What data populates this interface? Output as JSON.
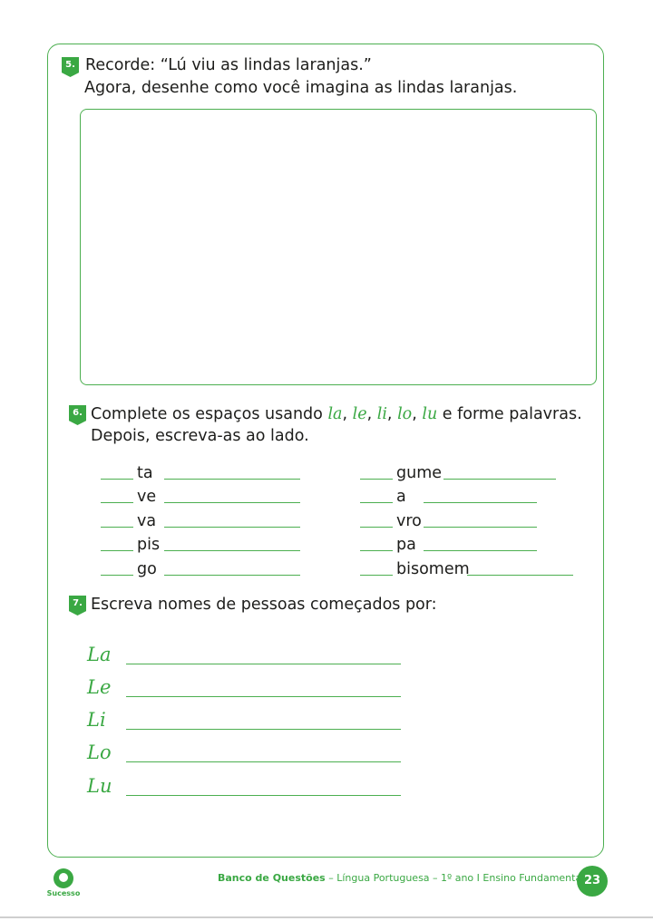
{
  "q5": {
    "number": "5.",
    "line1": "Recorde: “Lú viu as lindas laranjas.”",
    "line2": "Agora, desenhe como você imagina as lindas laranjas."
  },
  "q6": {
    "number": "6.",
    "prefix": "Complete os espaços usando",
    "syllables": [
      "la",
      "le",
      "li",
      "lo",
      "lu"
    ],
    "sep": ", ",
    "suffix": "e forme palavras.",
    "line2": "Depois, escreva-as ao lado.",
    "left_items": [
      "ta",
      "ve",
      "va",
      "pis",
      "go"
    ],
    "right_items": [
      "gume",
      "a",
      "vro",
      "pa",
      "bisomem"
    ]
  },
  "q7": {
    "number": "7.",
    "text": "Escreva nomes de pessoas começados por:",
    "prompts": [
      "La",
      "Le",
      "Li",
      "Lo",
      "Lu"
    ]
  },
  "footer": {
    "logo_text": "Sucesso",
    "title_bold": "Banco de Questões",
    "title_rest": " – Língua Portuguesa – 1º ano I Ensino Fundamental",
    "page_number": "23"
  },
  "colors": {
    "accent": "#3aa843",
    "frame": "#4caf50"
  }
}
